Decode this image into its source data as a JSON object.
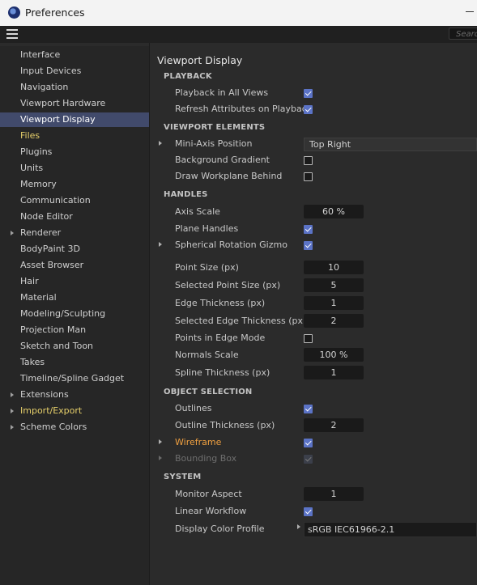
{
  "window": {
    "title": "Preferences"
  },
  "toolbar": {
    "search_placeholder": "Searc"
  },
  "sidebar": {
    "items": [
      {
        "label": "Interface"
      },
      {
        "label": "Input Devices"
      },
      {
        "label": "Navigation"
      },
      {
        "label": "Viewport Hardware"
      },
      {
        "label": "Viewport Display",
        "selected": true
      },
      {
        "label": "Files"
      },
      {
        "label": "Plugins"
      },
      {
        "label": "Units"
      },
      {
        "label": "Memory"
      },
      {
        "label": "Communication"
      },
      {
        "label": "Node Editor"
      },
      {
        "label": "Renderer",
        "expandable": true
      },
      {
        "label": "BodyPaint 3D"
      },
      {
        "label": "Asset Browser"
      },
      {
        "label": "Hair"
      },
      {
        "label": "Material"
      },
      {
        "label": "Modeling/Sculpting"
      },
      {
        "label": "Projection Man"
      },
      {
        "label": "Sketch and Toon"
      },
      {
        "label": "Takes"
      },
      {
        "label": "Timeline/Spline Gadget"
      },
      {
        "label": "Extensions",
        "expandable": true
      },
      {
        "label": "Import/Export",
        "expandable": true
      },
      {
        "label": "Scheme Colors",
        "expandable": true
      }
    ]
  },
  "panel": {
    "title": "Viewport Display",
    "sections": {
      "playback": "PLAYBACK",
      "viewport_elements": "VIEWPORT ELEMENTS",
      "handles": "HANDLES",
      "object_selection": "OBJECT SELECTION",
      "system": "SYSTEM"
    },
    "rows": {
      "playback_all_views": {
        "label": "Playback in All Views",
        "checked": true
      },
      "refresh_attributes": {
        "label": "Refresh Attributes on Playback",
        "checked": true
      },
      "mini_axis_position": {
        "label": "Mini-Axis Position",
        "value": "Top Right"
      },
      "background_gradient": {
        "label": "Background Gradient",
        "checked": false
      },
      "draw_workplane_behind": {
        "label": "Draw Workplane Behind",
        "checked": false
      },
      "axis_scale": {
        "label": "Axis Scale",
        "value": "60 %"
      },
      "plane_handles": {
        "label": "Plane Handles",
        "checked": true
      },
      "spherical_rotation_gizmo": {
        "label": "Spherical Rotation Gizmo",
        "checked": true
      },
      "point_size": {
        "label": "Point Size (px)",
        "value": "10"
      },
      "selected_point_size": {
        "label": "Selected Point Size (px)",
        "value": "5"
      },
      "edge_thickness": {
        "label": "Edge Thickness (px)",
        "value": "1"
      },
      "selected_edge_thickness": {
        "label": "Selected Edge Thickness (px)",
        "value": "2"
      },
      "points_in_edge_mode": {
        "label": "Points in Edge Mode",
        "checked": false
      },
      "normals_scale": {
        "label": "Normals Scale",
        "value": "100 %"
      },
      "spline_thickness": {
        "label": "Spline Thickness (px)",
        "value": "1"
      },
      "outlines": {
        "label": "Outlines",
        "checked": true
      },
      "outline_thickness": {
        "label": "Outline Thickness (px)",
        "value": "2"
      },
      "wireframe": {
        "label": "Wireframe",
        "checked": true
      },
      "bounding_box": {
        "label": "Bounding Box",
        "checked": true,
        "disabled": true
      },
      "monitor_aspect": {
        "label": "Monitor Aspect",
        "value": "1"
      },
      "linear_workflow": {
        "label": "Linear Workflow",
        "checked": true
      },
      "display_color_profile": {
        "label": "Display Color Profile",
        "value": "sRGB IEC61966-2.1"
      }
    }
  },
  "colors": {
    "accent": "#5b73c6",
    "selection_bg": "#414a6b",
    "highlight_yellow": "#e6cf6a",
    "highlight_orange": "#f0a040"
  }
}
